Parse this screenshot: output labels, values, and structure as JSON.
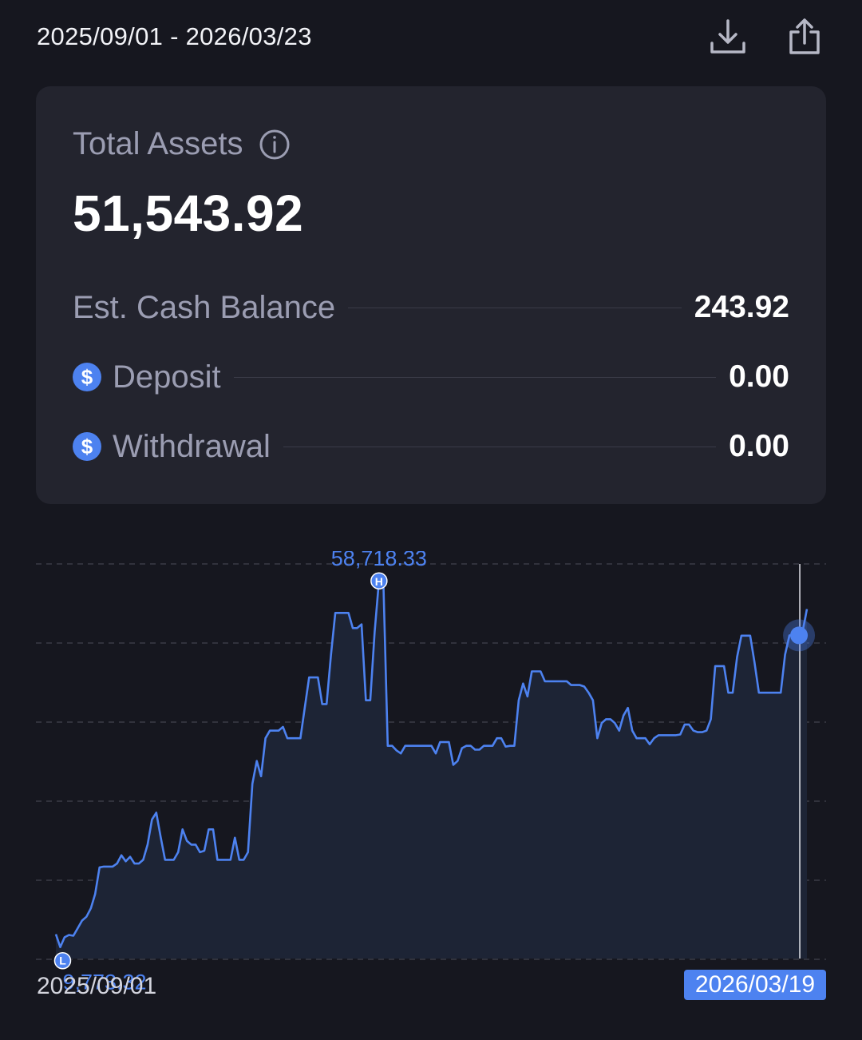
{
  "header": {
    "date_range": "2025/09/01 - 2026/03/23",
    "download_icon": "download-icon",
    "share_icon": "share-icon"
  },
  "summary": {
    "title": "Total Assets",
    "info_icon": "info-icon",
    "total_value": "51,543.92",
    "rows": [
      {
        "label": "Est. Cash Balance",
        "value": "243.92",
        "icon": null
      },
      {
        "label": "Deposit",
        "value": "0.00",
        "icon": "dollar-icon"
      },
      {
        "label": "Withdrawal",
        "value": "0.00",
        "icon": "dollar-icon"
      }
    ]
  },
  "chart_data": {
    "type": "area",
    "x_start_label": "2025/09/01",
    "x_selected_label": "2026/03/19",
    "high_label": "58,718.33",
    "low_label": "9,773.32",
    "high_marker": "H",
    "low_marker": "L",
    "ylim": [
      9000,
      60000
    ],
    "grid": true,
    "colors": {
      "line": "#4d82f0",
      "fill": "#1d2435",
      "grid": "#3a3b46"
    },
    "values": [
      12200,
      10500,
      11800,
      12100,
      12000,
      13000,
      14000,
      14500,
      15600,
      17500,
      21000,
      21100,
      21100,
      21100,
      21500,
      22600,
      21800,
      22400,
      21500,
      21500,
      22000,
      24000,
      27300,
      28200,
      25000,
      22000,
      22000,
      22000,
      23000,
      26000,
      24500,
      24000,
      24000,
      23000,
      23200,
      26000,
      26000,
      22000,
      22000,
      22000,
      22000,
      24900,
      22000,
      22000,
      23000,
      32000,
      35000,
      33000,
      38000,
      39000,
      39000,
      39000,
      39500,
      38000,
      38000,
      38000,
      38000,
      42000,
      46000,
      46000,
      46000,
      42500,
      42500,
      49000,
      54500,
      54500,
      54500,
      54500,
      52500,
      52500,
      53000,
      43000,
      43000,
      52000,
      58718,
      58718,
      37000,
      37000,
      36400,
      36000,
      37000,
      37000,
      37000,
      37000,
      37000,
      37000,
      37000,
      36000,
      37500,
      37500,
      37500,
      34500,
      35000,
      36700,
      37000,
      37000,
      36500,
      36500,
      37000,
      37000,
      37000,
      38000,
      38000,
      36900,
      37000,
      37000,
      43000,
      45200,
      43500,
      46800,
      46800,
      46800,
      45500,
      45500,
      45500,
      45500,
      45500,
      45500,
      45000,
      45000,
      45000,
      44800,
      44000,
      43000,
      38000,
      40000,
      40500,
      40500,
      40000,
      39000,
      41000,
      42000,
      39000,
      38000,
      38000,
      38000,
      37200,
      38000,
      38400,
      38400,
      38400,
      38400,
      38400,
      38500,
      39800,
      39800,
      39000,
      38800,
      38800,
      39000,
      40500,
      47500,
      47500,
      47500,
      44000,
      44000,
      48700,
      51500,
      51500,
      51500,
      48000,
      44000,
      44000,
      44000,
      44000,
      44000,
      44000,
      49000,
      51543.92,
      51543.92,
      51543.92,
      52000,
      55000
    ]
  }
}
